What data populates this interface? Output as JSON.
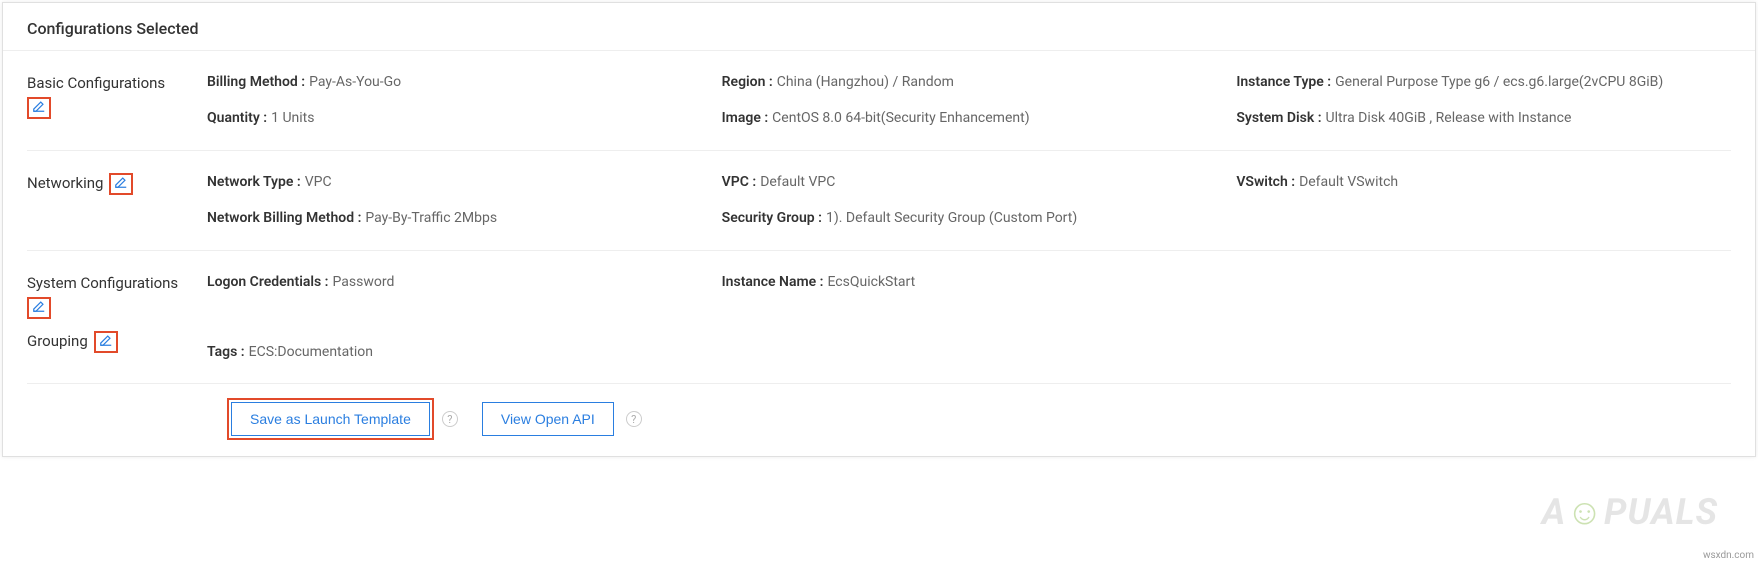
{
  "panel": {
    "title": "Configurations Selected"
  },
  "sections": {
    "basic": {
      "label": "Basic Configurations",
      "billing_method": {
        "key": "Billing Method",
        "val": "Pay-As-You-Go"
      },
      "region": {
        "key": "Region",
        "val": "China (Hangzhou) / Random"
      },
      "instance_type": {
        "key": "Instance Type",
        "val": "General Purpose Type g6 / ecs.g6.large(2vCPU 8GiB)"
      },
      "quantity": {
        "key": "Quantity",
        "val": "1 Units"
      },
      "image": {
        "key": "Image",
        "val": "CentOS 8.0 64-bit(Security Enhancement)"
      },
      "system_disk": {
        "key": "System Disk",
        "val": "Ultra Disk 40GiB , Release with Instance"
      }
    },
    "networking": {
      "label": "Networking",
      "network_type": {
        "key": "Network Type",
        "val": "VPC"
      },
      "vpc": {
        "key": "VPC",
        "val": "Default VPC"
      },
      "vswitch": {
        "key": "VSwitch",
        "val": "Default VSwitch"
      },
      "network_billing": {
        "key": "Network Billing Method",
        "val": "Pay-By-Traffic 2Mbps"
      },
      "security_group": {
        "key": "Security Group",
        "val": "1). Default Security Group (Custom Port)"
      }
    },
    "system": {
      "label": "System Configurations",
      "logon": {
        "key": "Logon Credentials",
        "val": "Password"
      },
      "instance_name": {
        "key": "Instance Name",
        "val": "EcsQuickStart"
      }
    },
    "grouping": {
      "label": "Grouping",
      "tags": {
        "key": "Tags",
        "val": "ECS:Documentation"
      }
    }
  },
  "footer": {
    "save_template": "Save as Launch Template",
    "view_api": "View Open API"
  },
  "watermark": {
    "prefix": "A",
    "suffix": "PUALS"
  },
  "attribution": "wsxdn.com"
}
